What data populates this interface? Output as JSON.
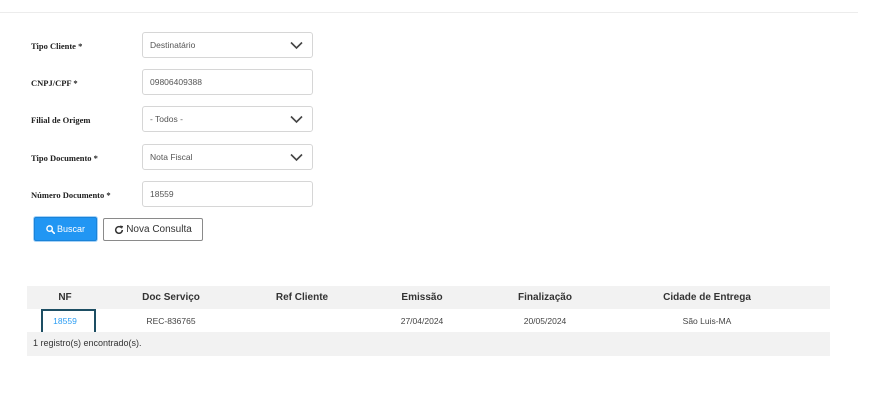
{
  "form": {
    "tipo_cliente": {
      "label": "Tipo Cliente *",
      "value": "Destinatário"
    },
    "cnpj_cpf": {
      "label": "CNPJ/CPF *",
      "value": "09806409388"
    },
    "filial_origem": {
      "label": "Filial de Origem",
      "value": "- Todos -"
    },
    "tipo_documento": {
      "label": "Tipo Documento *",
      "value": "Nota Fiscal"
    },
    "numero_documento": {
      "label": "Número Documento *",
      "value": "18559"
    }
  },
  "actions": {
    "buscar_label": "Buscar",
    "nova_consulta_label": "Nova Consulta"
  },
  "icons": {
    "search": "search-icon",
    "refresh": "refresh-icon",
    "dropdown": "chevron-down-icon"
  },
  "colors": {
    "primary": "#2196f3",
    "link": "#2a9df4",
    "highlight_border": "#1d4e63"
  },
  "results": {
    "columns": [
      "NF",
      "Doc Serviço",
      "Ref Cliente",
      "Emissão",
      "Finalização",
      "Cidade de Entrega"
    ],
    "rows": [
      {
        "nf": "18559",
        "doc_servico": "REC-836765",
        "ref_cliente": "",
        "emissao": "27/04/2024",
        "finalizacao": "20/05/2024",
        "cidade_entrega": "São Luis-MA"
      }
    ],
    "footer": "1 registro(s) encontrado(s)."
  }
}
